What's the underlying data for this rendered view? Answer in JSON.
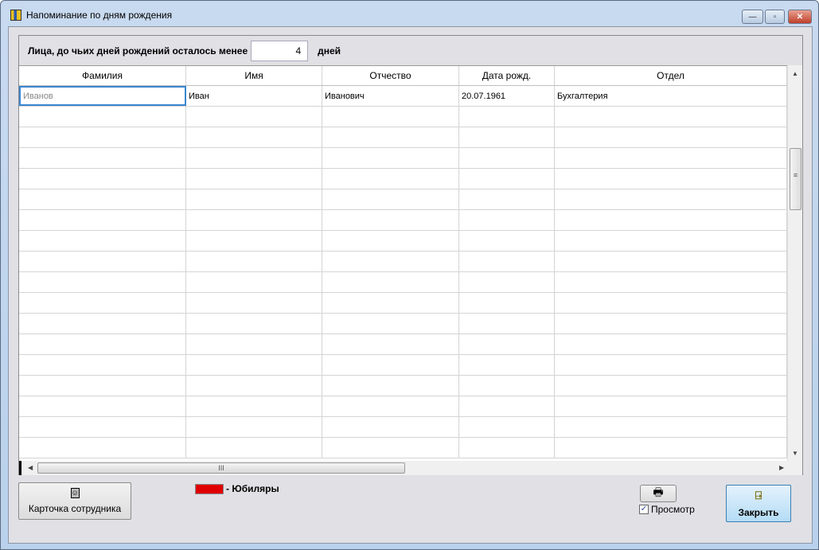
{
  "window": {
    "title": "Напоминание по дням рождения",
    "buttons": {
      "minimize": "—",
      "maximize": "▫",
      "close": "✕"
    }
  },
  "filter": {
    "label": "Лица, до чьих дней рождений осталось менее",
    "value": "4",
    "suffix": "дней"
  },
  "table": {
    "columns": [
      "Фамилия",
      "Имя",
      "Отчество",
      "Дата рожд.",
      "Отдел"
    ],
    "rows": [
      [
        "Иванов",
        "Иван",
        "Иванович",
        "20.07.1961",
        "Бухгалтерия"
      ]
    ]
  },
  "footer": {
    "card_button": "Карточка сотрудника",
    "legend_label": "- Юбиляры",
    "legend_color": "#e00000",
    "preview_label": "Просмотр",
    "preview_checked": true,
    "close_button": "Закрыть"
  }
}
